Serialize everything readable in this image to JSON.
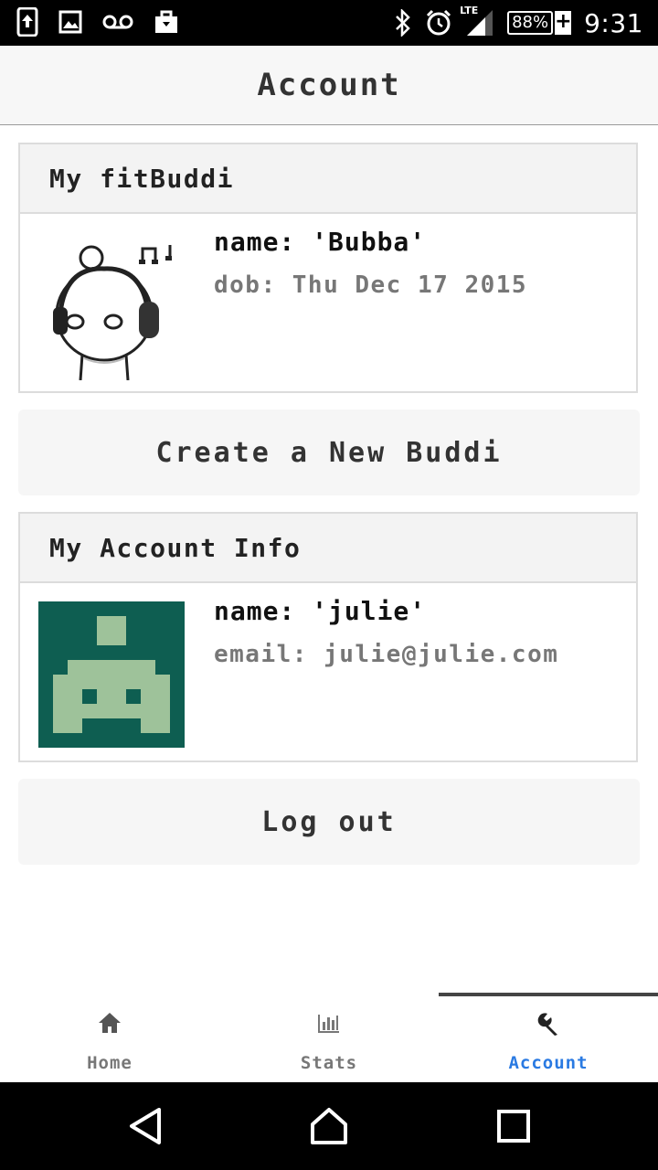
{
  "status_bar": {
    "time": "9:31",
    "battery": "88%",
    "network": "LTE",
    "icons": [
      "upload-icon",
      "image-icon",
      "voicemail-icon",
      "briefcase-icon",
      "bluetooth-icon",
      "alarm-icon",
      "signal-icon",
      "battery-icon"
    ]
  },
  "header": {
    "title": "Account"
  },
  "buddi_card": {
    "title": "My fitBuddi",
    "name_line": "name: 'Bubba'",
    "dob_line": "dob: Thu Dec 17 2015",
    "avatar_icon": "buddi-headphones-icon"
  },
  "create_button": {
    "label": "Create a New Buddi"
  },
  "account_card": {
    "title": "My Account Info",
    "name_line": "name: 'julie'",
    "email_line": "email: julie@julie.com",
    "avatar_icon": "space-invader-icon",
    "avatar_colors": {
      "background": "#0e5e51",
      "foreground": "#9ec29a"
    }
  },
  "logout_button": {
    "label": "Log out"
  },
  "tabs": [
    {
      "label": "Home",
      "icon": "home-icon",
      "active": false
    },
    {
      "label": "Stats",
      "icon": "bar-chart-icon",
      "active": false
    },
    {
      "label": "Account",
      "icon": "wrench-icon",
      "active": true
    }
  ],
  "colors": {
    "accent": "#2a7ae2",
    "header_bg": "#f7f7f7"
  },
  "nav_bar": {
    "buttons": [
      "back-icon",
      "home-circle-icon",
      "recents-icon"
    ]
  }
}
